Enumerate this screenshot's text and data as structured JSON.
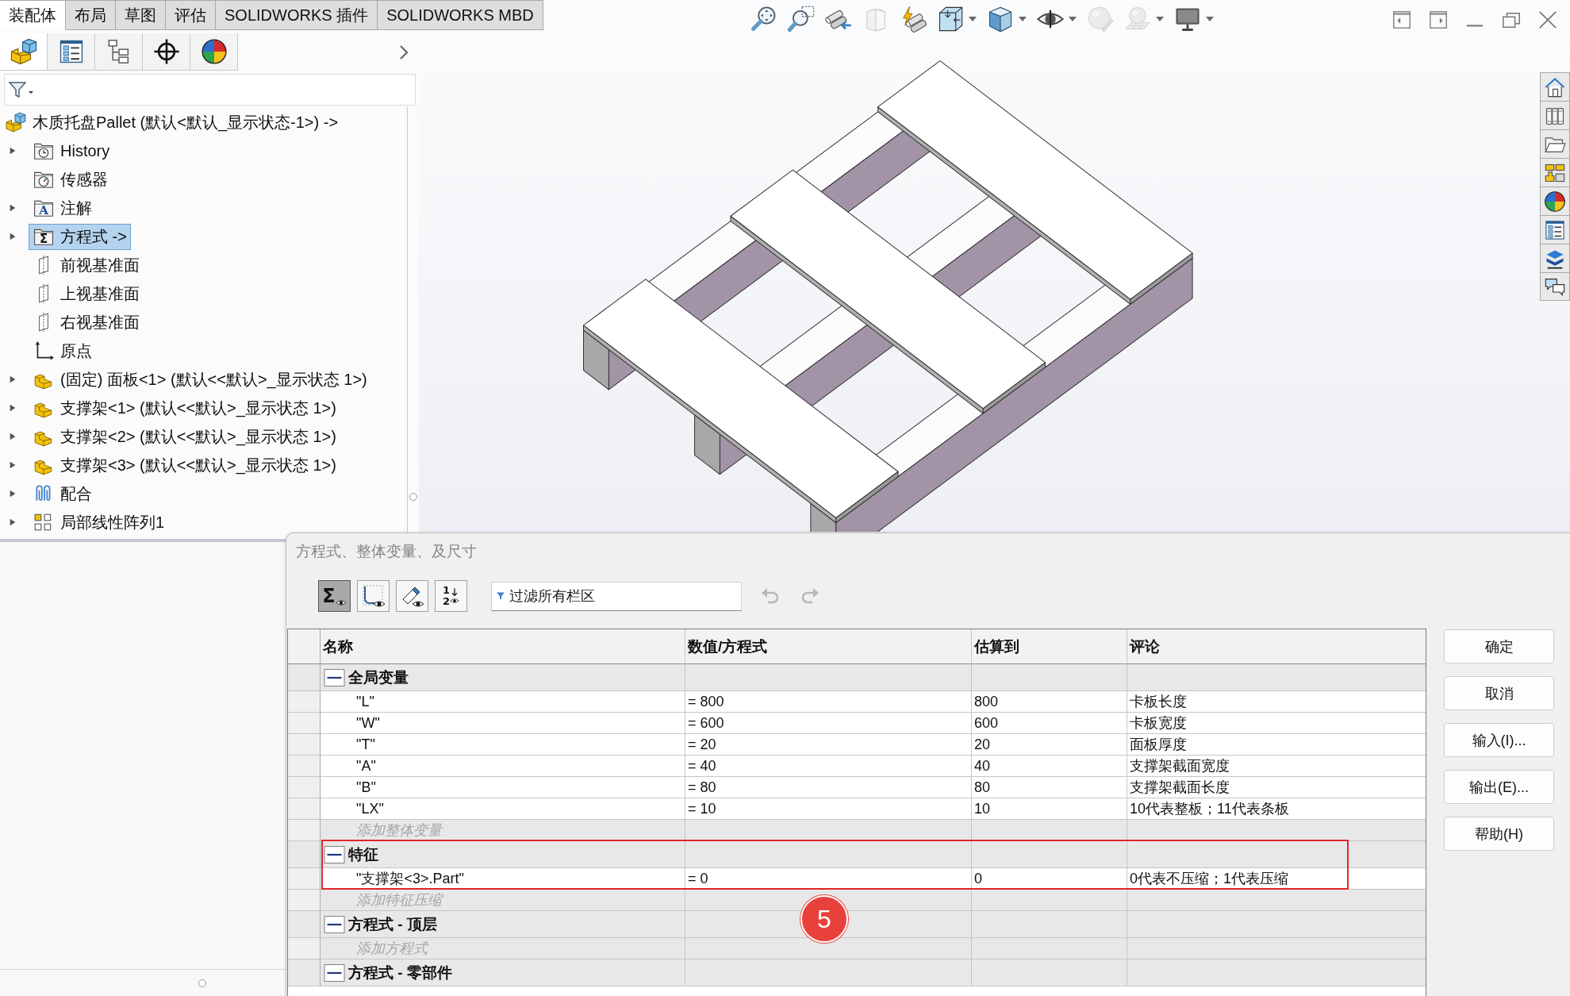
{
  "ribbon_tabs": [
    {
      "label": "装配体",
      "selected": true
    },
    {
      "label": "布局",
      "selected": false
    },
    {
      "label": "草图",
      "selected": false
    },
    {
      "label": "评估",
      "selected": false
    },
    {
      "label": "SOLIDWORKS 插件",
      "selected": false
    },
    {
      "label": "SOLIDWORKS MBD",
      "selected": false
    }
  ],
  "view_toolbar": [
    {
      "kind": "zoom-fit",
      "disabled": false,
      "menu": false
    },
    {
      "kind": "zoom-area",
      "disabled": false,
      "menu": false
    },
    {
      "kind": "previous-view",
      "disabled": false,
      "menu": false
    },
    {
      "kind": "section-view",
      "disabled": true,
      "menu": false
    },
    {
      "kind": "annotation-view",
      "disabled": false,
      "menu": false
    },
    {
      "kind": "view-orientation",
      "disabled": false,
      "menu": true
    },
    {
      "kind": "display-style",
      "disabled": false,
      "menu": true
    },
    {
      "kind": "hide-show",
      "disabled": false,
      "menu": true
    },
    {
      "kind": "appearance",
      "disabled": true,
      "menu": false
    },
    {
      "kind": "scene",
      "disabled": true,
      "menu": true
    },
    {
      "kind": "view-settings",
      "disabled": false,
      "menu": true
    }
  ],
  "panel_tabs": [
    {
      "kind": "feature-manager",
      "selected": true
    },
    {
      "kind": "property-manager",
      "selected": false
    },
    {
      "kind": "configuration-manager",
      "selected": false
    },
    {
      "kind": "dimxpert",
      "selected": false
    },
    {
      "kind": "display-manager",
      "selected": false
    }
  ],
  "feature_tree": {
    "kind": "assembly",
    "label": "木质托盘Pallet (默认<默认_显示状态-1>) ->",
    "selected": false,
    "children": [
      {
        "kind": "history",
        "label": "History",
        "expanded": false,
        "selected": false
      },
      {
        "kind": "sensors",
        "label": "传感器",
        "selected": false
      },
      {
        "kind": "annotations",
        "glyph": "A",
        "label": "注解",
        "expanded": false,
        "selected": false
      },
      {
        "kind": "equations",
        "glyph": "Σ",
        "label": "方程式 ->",
        "expanded": false,
        "selected": true
      },
      {
        "kind": "plane",
        "label": "前视基准面",
        "selected": false
      },
      {
        "kind": "plane",
        "label": "上视基准面",
        "selected": false
      },
      {
        "kind": "plane",
        "label": "右视基准面",
        "selected": false
      },
      {
        "kind": "origin",
        "label": "原点",
        "selected": false
      },
      {
        "kind": "part",
        "label": "(固定) 面板<1> (默认<<默认>_显示状态 1>)",
        "expanded": false,
        "selected": false
      },
      {
        "kind": "part",
        "label": "支撑架<1> (默认<<默认>_显示状态 1>)",
        "expanded": false,
        "selected": false
      },
      {
        "kind": "part",
        "label": "支撑架<2> (默认<<默认>_显示状态 1>)",
        "expanded": false,
        "selected": false
      },
      {
        "kind": "part",
        "label": "支撑架<3> (默认<<默认>_显示状态 1>)",
        "expanded": false,
        "selected": false
      },
      {
        "kind": "mates",
        "label": "配合",
        "expanded": false,
        "selected": false
      },
      {
        "kind": "pattern",
        "label": "局部线性阵列1",
        "expanded": false,
        "selected": false
      }
    ]
  },
  "dialog": {
    "title": "方程式、整体变量、及尺寸",
    "view_buttons": [
      {
        "kind": "equations",
        "glyph": "Σ",
        "selected": true
      },
      {
        "kind": "sketch-equations",
        "selected": false
      },
      {
        "kind": "dimensions",
        "selected": false
      },
      {
        "kind": "ordered",
        "glyph": "1 2",
        "selected": false
      }
    ],
    "filter": {
      "placeholder": "过滤所有栏区"
    },
    "history_buttons": [
      {
        "kind": "undo",
        "disabled": true
      },
      {
        "kind": "redo",
        "disabled": true
      }
    ],
    "table": {
      "columns": [
        "名称",
        "数值/方程式",
        "估算到",
        "评论"
      ],
      "sections": [
        {
          "title": "全局变量",
          "expanded": true,
          "rows": [
            {
              "name": "\"L\"",
              "value": "= 800",
              "evaluates_to": "800",
              "comment": "卡板长度"
            },
            {
              "name": "\"W\"",
              "value": "= 600",
              "evaluates_to": "600",
              "comment": "卡板宽度"
            },
            {
              "name": "\"T\"",
              "value": "= 20",
              "evaluates_to": "20",
              "comment": "面板厚度"
            },
            {
              "name": "\"A\"",
              "value": "= 40",
              "evaluates_to": "40",
              "comment": "支撑架截面宽度"
            },
            {
              "name": "\"B\"",
              "value": "= 80",
              "evaluates_to": "80",
              "comment": "支撑架截面长度"
            },
            {
              "name": "\"LX\"",
              "value": "= 10",
              "evaluates_to": "10",
              "comment": "10代表整板；11代表条板"
            }
          ],
          "add_row": {
            "placeholder": "添加整体变量"
          }
        },
        {
          "title": "特征",
          "expanded": true,
          "rows": [
            {
              "name": "\"支撑架<3>.Part\"",
              "value": "= 0",
              "evaluates_to": "0",
              "comment": "0代表不压缩；1代表压缩"
            }
          ],
          "add_row": {
            "placeholder": "添加特征压缩"
          }
        },
        {
          "title": "方程式 - 顶层",
          "expanded": true,
          "add_row": {
            "placeholder": "添加方程式"
          }
        },
        {
          "title": "方程式 - 零部件",
          "expanded": true
        }
      ]
    },
    "buttons": [
      "确定",
      "取消",
      "输入(I)...",
      "输出(E)...",
      "帮助(H)"
    ]
  },
  "annotation": {
    "badge": "5"
  }
}
